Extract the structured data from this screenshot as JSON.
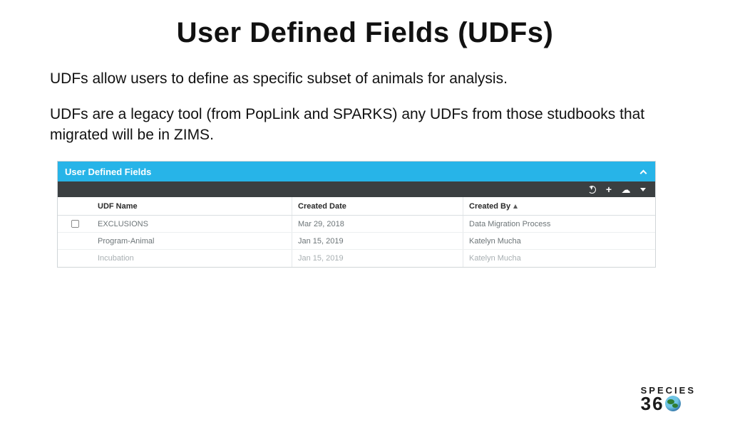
{
  "title": "User Defined Fields (UDFs)",
  "intro": {
    "p1": "UDFs allow users to define as specific subset of animals for analysis.",
    "p2": "UDFs are a legacy tool (from PopLink and SPARKS) any UDFs from those studbooks that migrated will be in ZIMS."
  },
  "panel": {
    "title": "User Defined Fields",
    "columns": {
      "udf_name": "UDF Name",
      "created_date": "Created Date",
      "created_by": "Created By"
    },
    "rows": [
      {
        "checked": false,
        "name": "EXCLUSIONS",
        "date": "Mar 29, 2018",
        "by": "Data Migration Process"
      },
      {
        "checked": false,
        "name": "Program-Animal",
        "date": "Jan 15, 2019",
        "by": "Katelyn Mucha"
      },
      {
        "checked": false,
        "name": "Incubation",
        "date": "Jan 15, 2019",
        "by": "Katelyn Mucha"
      }
    ]
  },
  "logo": {
    "line1": "SPECIES",
    "d1": "3",
    "d2": "6",
    "d3": "0"
  }
}
